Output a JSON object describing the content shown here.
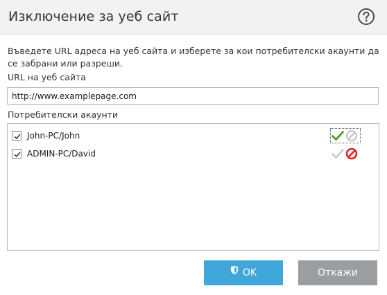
{
  "dialog": {
    "title": "Изключение за уеб сайт",
    "help_icon": "question-circle-icon"
  },
  "description": "Въведете URL адреса на уеб сайта и изберете за кои потребителски акаунти да се забрани или разреши.",
  "url": {
    "label": "URL на уеб сайта",
    "value": "http://www.examplepage.com"
  },
  "accounts": {
    "label": "Потребителски акаунти",
    "items": [
      {
        "name": "John-PC/John",
        "checked": true,
        "permission": "allow",
        "focused": true
      },
      {
        "name": "ADMIN-PC/David",
        "checked": true,
        "permission": "block",
        "focused": false
      }
    ]
  },
  "buttons": {
    "ok_label": "OK",
    "cancel_label": "Откажи"
  },
  "colors": {
    "accent": "#3fa7d9",
    "cancel": "#9a9ea1",
    "allow_green": "#5aa020",
    "block_red": "#e0202a",
    "inactive_gray": "#c8c8c8"
  }
}
